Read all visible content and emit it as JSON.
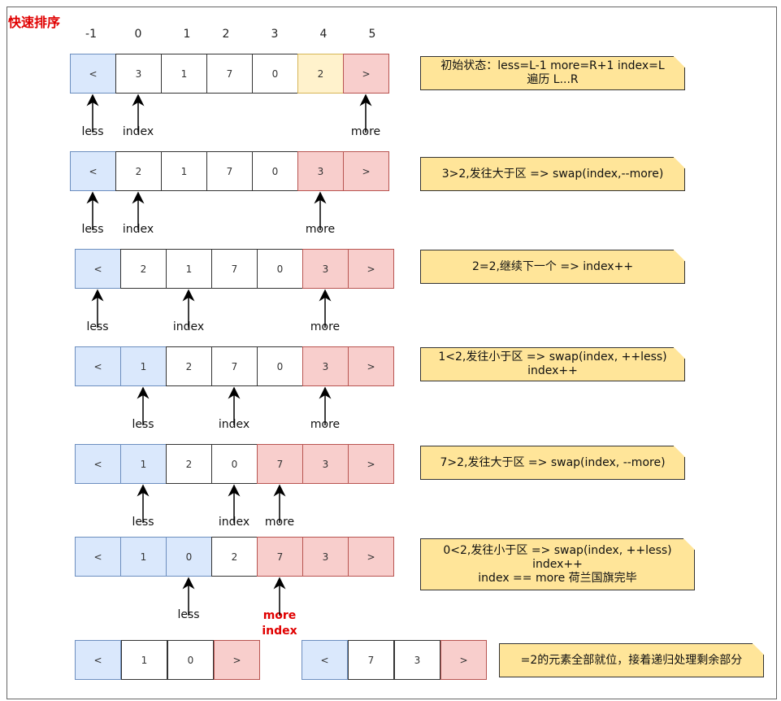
{
  "title": "快速排序",
  "headers": [
    "-1",
    "0",
    "1",
    "2",
    "3",
    "4",
    "5"
  ],
  "rows": [
    {
      "cells": [
        [
          "<",
          "blue"
        ],
        [
          "3",
          "white"
        ],
        [
          "1",
          "white"
        ],
        [
          "7",
          "white"
        ],
        [
          "0",
          "white"
        ],
        [
          "2",
          "yellow"
        ],
        [
          ">",
          "red"
        ]
      ],
      "labels": [
        [
          "less",
          0
        ],
        [
          "index",
          1
        ],
        [
          "more",
          6
        ]
      ],
      "note": [
        "初始状态：less=L-1 more=R+1 index=L",
        "遍历 L...R"
      ]
    },
    {
      "cells": [
        [
          "<",
          "blue"
        ],
        [
          "2",
          "white"
        ],
        [
          "1",
          "white"
        ],
        [
          "7",
          "white"
        ],
        [
          "0",
          "white"
        ],
        [
          "3",
          "red"
        ],
        [
          ">",
          "red"
        ]
      ],
      "labels": [
        [
          "less",
          0
        ],
        [
          "index",
          1
        ],
        [
          "more",
          5
        ]
      ],
      "note": [
        "3>2,发往大于区 => swap(index,--more)"
      ]
    },
    {
      "cells": [
        [
          "<",
          "blue"
        ],
        [
          "2",
          "white"
        ],
        [
          "1",
          "white"
        ],
        [
          "7",
          "white"
        ],
        [
          "0",
          "white"
        ],
        [
          "3",
          "red"
        ],
        [
          ">",
          "red"
        ]
      ],
      "labels": [
        [
          "less",
          0
        ],
        [
          "index",
          2
        ],
        [
          "more",
          5
        ]
      ],
      "note": [
        "2=2,继续下一个 => index++"
      ]
    },
    {
      "cells": [
        [
          "<",
          "blue"
        ],
        [
          "1",
          "blue"
        ],
        [
          "2",
          "white"
        ],
        [
          "7",
          "white"
        ],
        [
          "0",
          "white"
        ],
        [
          "3",
          "red"
        ],
        [
          ">",
          "red"
        ]
      ],
      "labels": [
        [
          "less",
          1
        ],
        [
          "index",
          3
        ],
        [
          "more",
          5
        ]
      ],
      "note": [
        "1<2,发往小于区 => swap(index, ++less)",
        "index++"
      ]
    },
    {
      "cells": [
        [
          "<",
          "blue"
        ],
        [
          "1",
          "blue"
        ],
        [
          "2",
          "white"
        ],
        [
          "0",
          "white"
        ],
        [
          "7",
          "red"
        ],
        [
          "3",
          "red"
        ],
        [
          ">",
          "red"
        ]
      ],
      "labels": [
        [
          "less",
          1
        ],
        [
          "index",
          3
        ],
        [
          "more",
          4
        ]
      ],
      "note": [
        "7>2,发往大于区 => swap(index, --more)"
      ]
    },
    {
      "cells": [
        [
          "<",
          "blue"
        ],
        [
          "1",
          "blue"
        ],
        [
          "0",
          "blue"
        ],
        [
          "2",
          "white"
        ],
        [
          "7",
          "red"
        ],
        [
          "3",
          "red"
        ],
        [
          ">",
          "red"
        ]
      ],
      "labels": [
        [
          "less",
          2
        ],
        [
          "more\nindex",
          4
        ]
      ],
      "note": [
        "0<2,发往小于区 => swap(index, ++less)",
        "index++",
        "index == more 荷兰国旗完毕"
      ]
    }
  ],
  "final": {
    "left": [
      [
        "<",
        "blue"
      ],
      [
        "1",
        "white"
      ],
      [
        "0",
        "white"
      ],
      [
        ">",
        "red"
      ]
    ],
    "right": [
      [
        "<",
        "blue"
      ],
      [
        "7",
        "white"
      ],
      [
        "3",
        "white"
      ],
      [
        ">",
        "red"
      ]
    ],
    "note": "=2的元素全部就位，接着递归处理剩余部分"
  }
}
